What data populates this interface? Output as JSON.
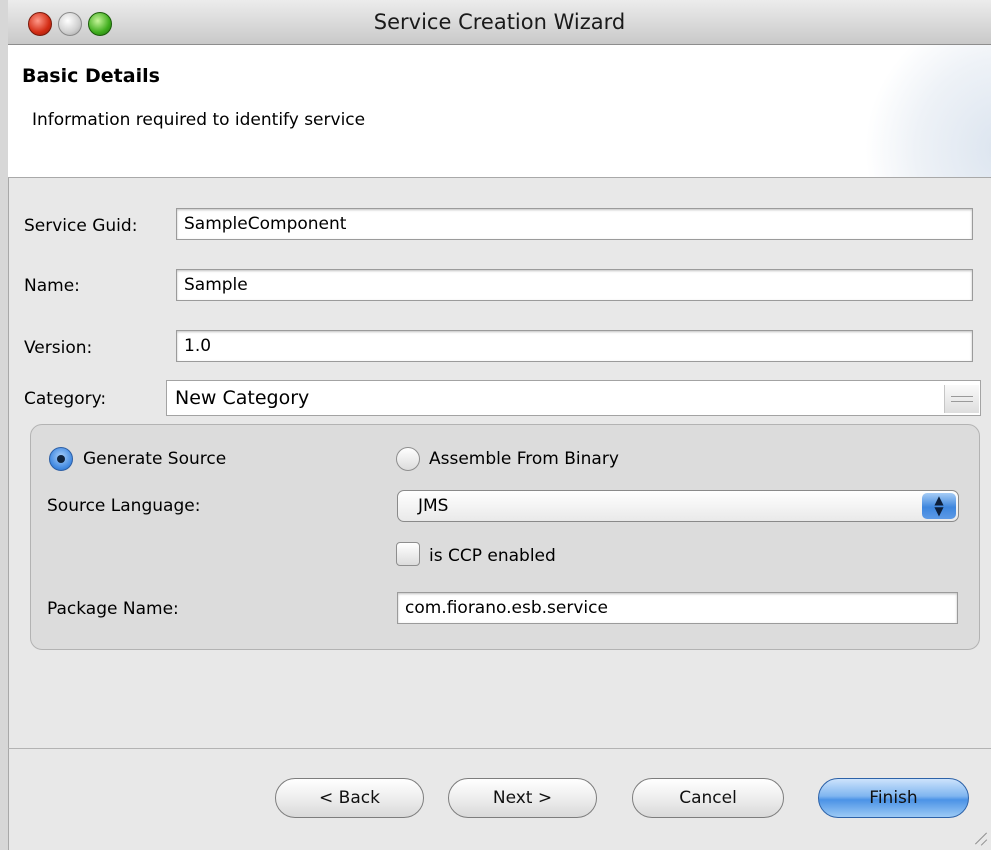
{
  "window": {
    "title": "Service Creation Wizard"
  },
  "banner": {
    "heading": "Basic Details",
    "description": "Information required to identify service"
  },
  "form": {
    "service_guid": {
      "label": "Service Guid:",
      "value": "SampleComponent"
    },
    "name": {
      "label": "Name:",
      "value": "Sample"
    },
    "version": {
      "label": "Version:",
      "value": "1.0"
    },
    "category": {
      "label": "Category:",
      "value": "New Category"
    }
  },
  "source_group": {
    "generate_source": {
      "label": "Generate Source",
      "selected": true
    },
    "assemble_from_binary": {
      "label": "Assemble From Binary",
      "selected": false
    },
    "source_language": {
      "label": "Source Language:",
      "selected_value": "JMS"
    },
    "ccp_enabled": {
      "label": "is CCP enabled",
      "checked": false
    },
    "package_name": {
      "label": "Package Name:",
      "value": "com.fiorano.esb.service"
    }
  },
  "buttons": {
    "back": "< Back",
    "next": "Next >",
    "cancel": "Cancel",
    "finish": "Finish"
  },
  "colors": {
    "window_background": "#e8e8e8",
    "banner_background": "#ffffff",
    "group_background": "#dcdcdc",
    "accent_blue": "#4b93e6"
  },
  "icons": {
    "close": "close-icon",
    "minimize": "minimize-icon",
    "zoom": "zoom-icon",
    "select_arrows": "updown-arrows-icon",
    "resize": "resize-grip-icon"
  }
}
